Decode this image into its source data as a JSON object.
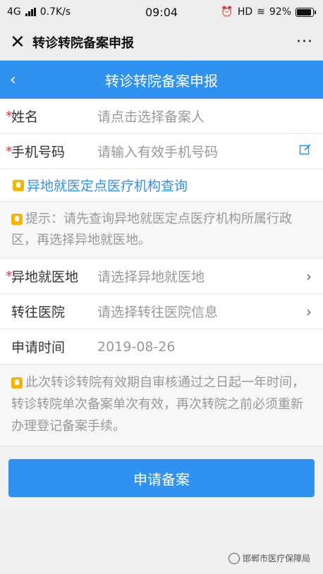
{
  "status_bar": {
    "network": "4G",
    "speed": "0.7K/s",
    "time": "09:04",
    "hd": "HD",
    "battery": "92%",
    "battery_level": 0.92
  },
  "wechat_bar": {
    "close_icon": "close-icon",
    "title": "转诊转院备案申报",
    "more": "···"
  },
  "app_bar": {
    "back": "‹",
    "title": "转诊转院备案申报"
  },
  "form": {
    "name": {
      "required": "*",
      "label": "姓名",
      "placeholder": "请点击选择备案人"
    },
    "phone": {
      "required": "*",
      "label": "手机号码",
      "placeholder": "请输入有效手机号码"
    },
    "query_link": "异地就医定点医疗机构查询",
    "hint": "提示：请先查询异地就医定点医疗机构所属行政区，再选择异地就医地。",
    "location": {
      "required": "*",
      "label": "异地就医地",
      "placeholder": "请选择异地就医地"
    },
    "hospital": {
      "label": "转往医院",
      "placeholder": "请选择转往医院信息"
    },
    "date": {
      "label": "申请时间",
      "value": "2019-08-26"
    },
    "note": "此次转诊转院有效期自审核通过之日起一年时间，转诊转院单次备案单次有效，再次转院之前必须重新办理登记备案手续。"
  },
  "submit_label": "申请备案",
  "watermark": "邯郸市医疗保障局",
  "colors": {
    "primary": "#2f91f0",
    "required": "#e53935",
    "bulb": "#f5b400"
  }
}
